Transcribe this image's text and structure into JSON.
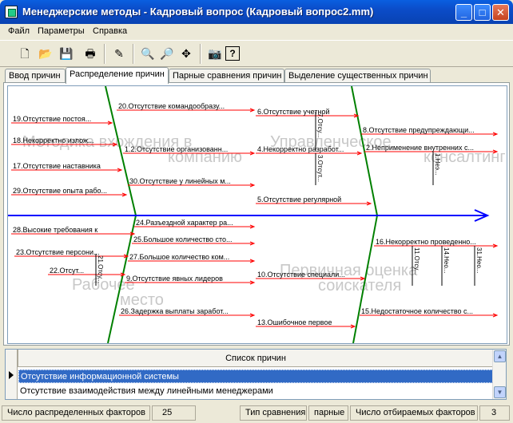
{
  "window": {
    "title": "Менеджерские методы - Кадровый вопрос (Кадровый вопрос2.mm)",
    "min_glyph": "_",
    "max_glyph": "□",
    "close_glyph": "✕"
  },
  "menu": [
    "Файл",
    "Параметры",
    "Справка"
  ],
  "toolbar": [
    {
      "icon": "new-document-icon",
      "glyph": "🗋"
    },
    {
      "icon": "open-folder-icon",
      "glyph": "📂"
    },
    {
      "icon": "save-disk-icon",
      "glyph": "💾"
    },
    {
      "icon": "print-icon",
      "glyph": "🖶"
    },
    {
      "icon": "magic-tool-icon",
      "glyph": "✎"
    },
    {
      "icon": "zoom-in-icon",
      "glyph": "🔍"
    },
    {
      "icon": "zoom-out-icon",
      "glyph": "🔎"
    },
    {
      "icon": "pan-move-icon",
      "glyph": "✥"
    },
    {
      "icon": "camera-icon",
      "glyph": "📷"
    },
    {
      "icon": "help-icon",
      "glyph": "?"
    }
  ],
  "tabs": [
    "Ввод причин",
    "Распределение причин",
    "Парные сравнения причин",
    "Выделение существенных причин"
  ],
  "active_tab_index": 1,
  "diagram": {
    "colors": {
      "spine": "#0000FF",
      "bone": "#008000",
      "cause_line": "#FF0000",
      "label": "#000000",
      "watermark": "#C8C8C8"
    },
    "categories": [
      {
        "name": "Методика вхождения в компанию"
      },
      {
        "name": "Управленческое консалтинг"
      },
      {
        "name": "Рабочее место"
      },
      {
        "name": "Первичная оценка соискателя"
      }
    ],
    "causes": [
      "19.Отсутствие постоя...",
      "18.Некорректно излож...",
      "17.Отсутствие наставника",
      "29.Отсутствие опыта рабо...",
      "20.Отсутствие командообразу...",
      "1.2.Отсутствие организованн...",
      "30.Отсутствие у линейных м...",
      "6.Отсутствие учетной",
      "4.Некорректно разработ...",
      "5.Отсутствие регулярной",
      "8.Отсутствие предупреждающи...",
      "2.Неприменение внутренних с...",
      "28.Высокие требования к",
      "23.Отсутствие персони...",
      "24.Разъездной характер ра...",
      "25.Большое количество сто...",
      "27.Большое количество ком...",
      "9.Отсутствие явных лидеров",
      "26.Задержка выплаты заработ...",
      "10.Отсутствие специали...",
      "13.Ошибочное первое",
      "16.Некорректно проведенно...",
      "15.Недостаточное количество с...",
      "22.Отсут..."
    ],
    "vertical_causes": [
      "7.Отсу...",
      "3.Отсут...",
      "1.Неэ...",
      "21.Отсу...",
      "11.Отсу...",
      "14.Нео...",
      "31.Нео..."
    ]
  },
  "list": {
    "header": "Список причин",
    "rows": [
      "Отсутствие информационной системы",
      "Отсутствие взаимодействия между линейными менеджерами"
    ],
    "selected_index": 0,
    "scroll_up_glyph": "▲",
    "scroll_down_glyph": "▼"
  },
  "status": {
    "distributed_label": "Число распределенных факторов",
    "distributed_value": "25",
    "comparison_label": "Тип сравнения",
    "comparison_value": "парные",
    "selected_label": "Число отбираемых факторов",
    "selected_value": "3"
  }
}
